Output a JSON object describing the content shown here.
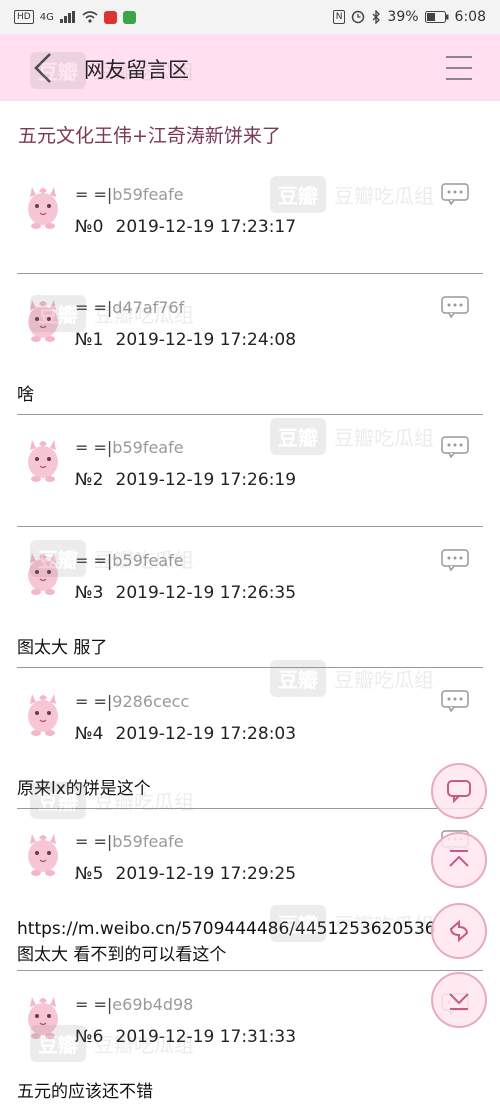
{
  "status_bar": {
    "battery": "39%",
    "time": "6:08",
    "network": "4G"
  },
  "header": {
    "title": "网友留言区"
  },
  "article": {
    "title": "五元文化王伟+江奇涛新饼来了"
  },
  "watermark": {
    "box": "豆瓣",
    "text": "豆瓣吃瓜组"
  },
  "comments": [
    {
      "user_prefix": "= =|",
      "user_id": "b59feafe",
      "number": "№0",
      "timestamp": "2019-12-19 17:23:17",
      "lines": []
    },
    {
      "user_prefix": "= =|",
      "user_id": "d47af76f",
      "number": "№1",
      "timestamp": "2019-12-19 17:24:08",
      "lines": [
        "啥"
      ]
    },
    {
      "user_prefix": "= =|",
      "user_id": "b59feafe",
      "number": "№2",
      "timestamp": "2019-12-19 17:26:19",
      "lines": []
    },
    {
      "user_prefix": "= =|",
      "user_id": "b59feafe",
      "number": "№3",
      "timestamp": "2019-12-19 17:26:35",
      "lines": [
        "图太大 服了"
      ]
    },
    {
      "user_prefix": "= =|",
      "user_id": "9286cecc",
      "number": "№4",
      "timestamp": "2019-12-19 17:28:03",
      "lines": [
        "原来lx的饼是这个"
      ]
    },
    {
      "user_prefix": "= =|",
      "user_id": "b59feafe",
      "number": "№5",
      "timestamp": "2019-12-19 17:29:25",
      "lines": [
        "https://m.weibo.cn/5709444486/4451253620536",
        "图太大 看不到的可以看这个"
      ]
    },
    {
      "user_prefix": "= =|",
      "user_id": "e69b4d98",
      "number": "№6",
      "timestamp": "2019-12-19 17:31:33",
      "lines": [
        "五元的应该还不错"
      ]
    }
  ],
  "fab_buttons": [
    {
      "name": "comment",
      "icon": "speech-bubble-icon"
    },
    {
      "name": "scroll-top",
      "icon": "arrow-up-bar-icon"
    },
    {
      "name": "refresh",
      "icon": "refresh-icon"
    },
    {
      "name": "scroll-bottom",
      "icon": "arrow-down-bar-icon"
    }
  ],
  "colors": {
    "header_bg": "#ffdff0",
    "article_title": "#7a3a54",
    "fab_border": "#e8a9c2"
  }
}
